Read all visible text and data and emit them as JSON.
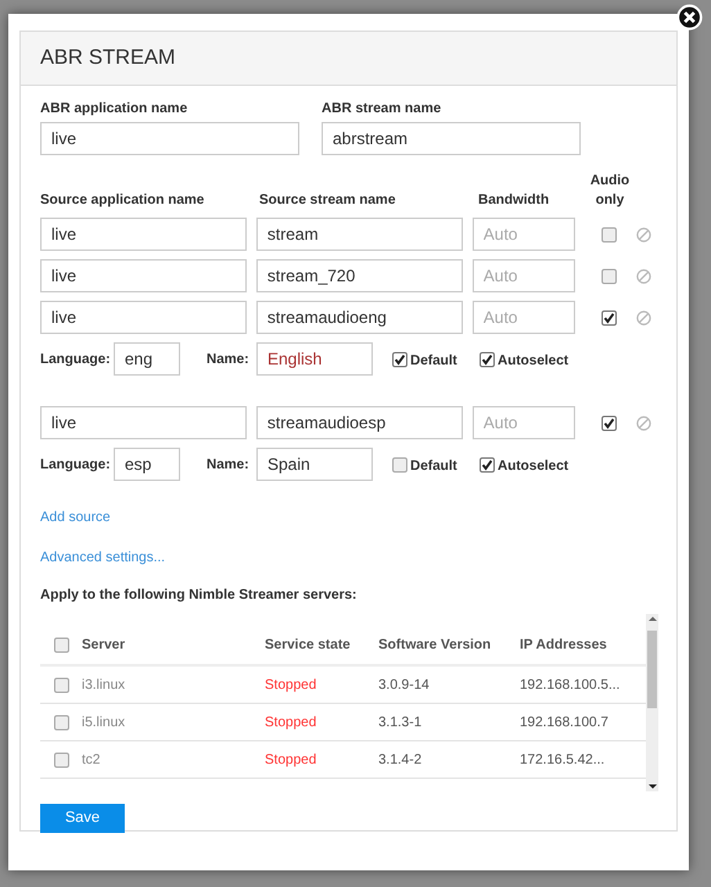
{
  "dialog": {
    "title": "ABR STREAM"
  },
  "abr": {
    "app_label": "ABR application name",
    "app_value": "live",
    "stream_label": "ABR stream name",
    "stream_value": "abrstream"
  },
  "source_columns": {
    "app": "Source application name",
    "stream": "Source stream name",
    "bandwidth": "Bandwidth",
    "audio_only": "Audio only"
  },
  "sources": [
    {
      "app": "live",
      "stream": "stream",
      "bandwidth_placeholder": "Auto",
      "audio_only": false
    },
    {
      "app": "live",
      "stream": "stream_720",
      "bandwidth_placeholder": "Auto",
      "audio_only": false
    },
    {
      "app": "live",
      "stream": "streamaudioeng",
      "bandwidth_placeholder": "Auto",
      "audio_only": true,
      "language": {
        "label": "Language:",
        "value": "eng",
        "name_label": "Name:",
        "name": "English",
        "default_label": "Default",
        "default": true,
        "autoselect_label": "Autoselect",
        "autoselect": true
      }
    },
    {
      "app": "live",
      "stream": "streamaudioesp",
      "bandwidth_placeholder": "Auto",
      "audio_only": true,
      "language": {
        "label": "Language:",
        "value": "esp",
        "name_label": "Name:",
        "name": "Spain",
        "default_label": "Default",
        "default": false,
        "autoselect_label": "Autoselect",
        "autoselect": true
      }
    }
  ],
  "links": [
    "Add source",
    "Advanced settings..."
  ],
  "servers_title": "Apply to the following Nimble Streamer servers:",
  "table": {
    "select_all": false,
    "columns": [
      "Server",
      "Service state",
      "Software Version",
      "IP Addresses"
    ],
    "rows": [
      {
        "checked": false,
        "server": "i3.linux",
        "state": "Stopped",
        "version": "3.0.9-14",
        "ip": "192.168.100.5..."
      },
      {
        "checked": false,
        "server": "i5.linux",
        "state": "Stopped",
        "version": "3.1.3-1",
        "ip": "192.168.100.7"
      },
      {
        "checked": false,
        "server": "tc2",
        "state": "Stopped",
        "version": "3.1.4-2",
        "ip": "172.16.5.42..."
      }
    ]
  },
  "save_button": "Save"
}
